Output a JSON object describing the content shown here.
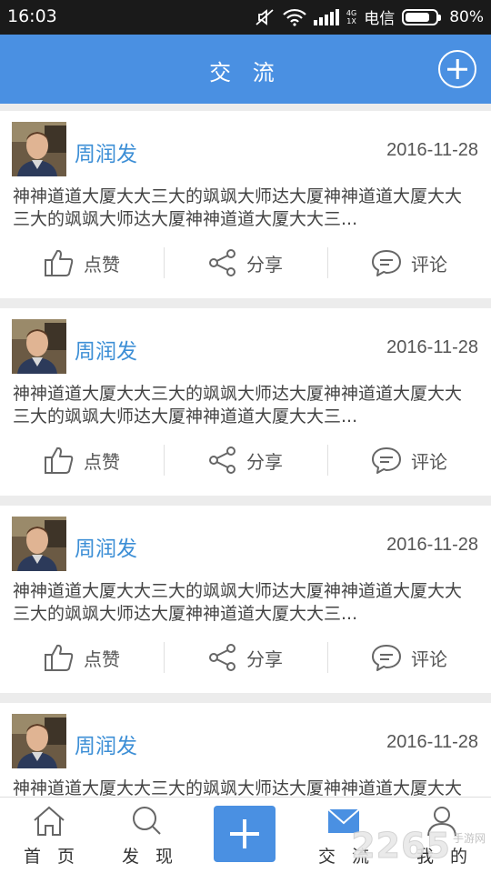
{
  "status_bar": {
    "time": "16:03",
    "network_small_top": "4G",
    "network_small_bottom": "1X",
    "carrier": "电信",
    "battery_percent_label": "80%",
    "battery_level": 0.8
  },
  "header": {
    "title": "交 流",
    "add_icon": "plus-circle-icon"
  },
  "posts": [
    {
      "author": "周润发",
      "date": "2016-11-28",
      "content": "神神道道大厦大大三大的飒飒大师达大厦神神道道大厦大大三大的飒飒大师达大厦神神道道大厦大大三..."
    },
    {
      "author": "周润发",
      "date": "2016-11-28",
      "content": "神神道道大厦大大三大的飒飒大师达大厦神神道道大厦大大三大的飒飒大师达大厦神神道道大厦大大三..."
    },
    {
      "author": "周润发",
      "date": "2016-11-28",
      "content": "神神道道大厦大大三大的飒飒大师达大厦神神道道大厦大大三大的飒飒大师达大厦神神道道大厦大大三..."
    },
    {
      "author": "周润发",
      "date": "2016-11-28",
      "content": "神神道道大厦大大三大的飒飒大师达大厦神神道道大厦大大三大的飒飒大师达大厦神神道道大厦大大三..."
    }
  ],
  "actions": {
    "like": "点赞",
    "share": "分享",
    "comment": "评论"
  },
  "bottom_nav": {
    "home": "首 页",
    "discover": "发 现",
    "chat": "交 流",
    "me": "我 的"
  },
  "watermark": {
    "number": "2265",
    "text": "手游网"
  },
  "colors": {
    "accent": "#4a90e2",
    "author": "#3d8fd6"
  }
}
